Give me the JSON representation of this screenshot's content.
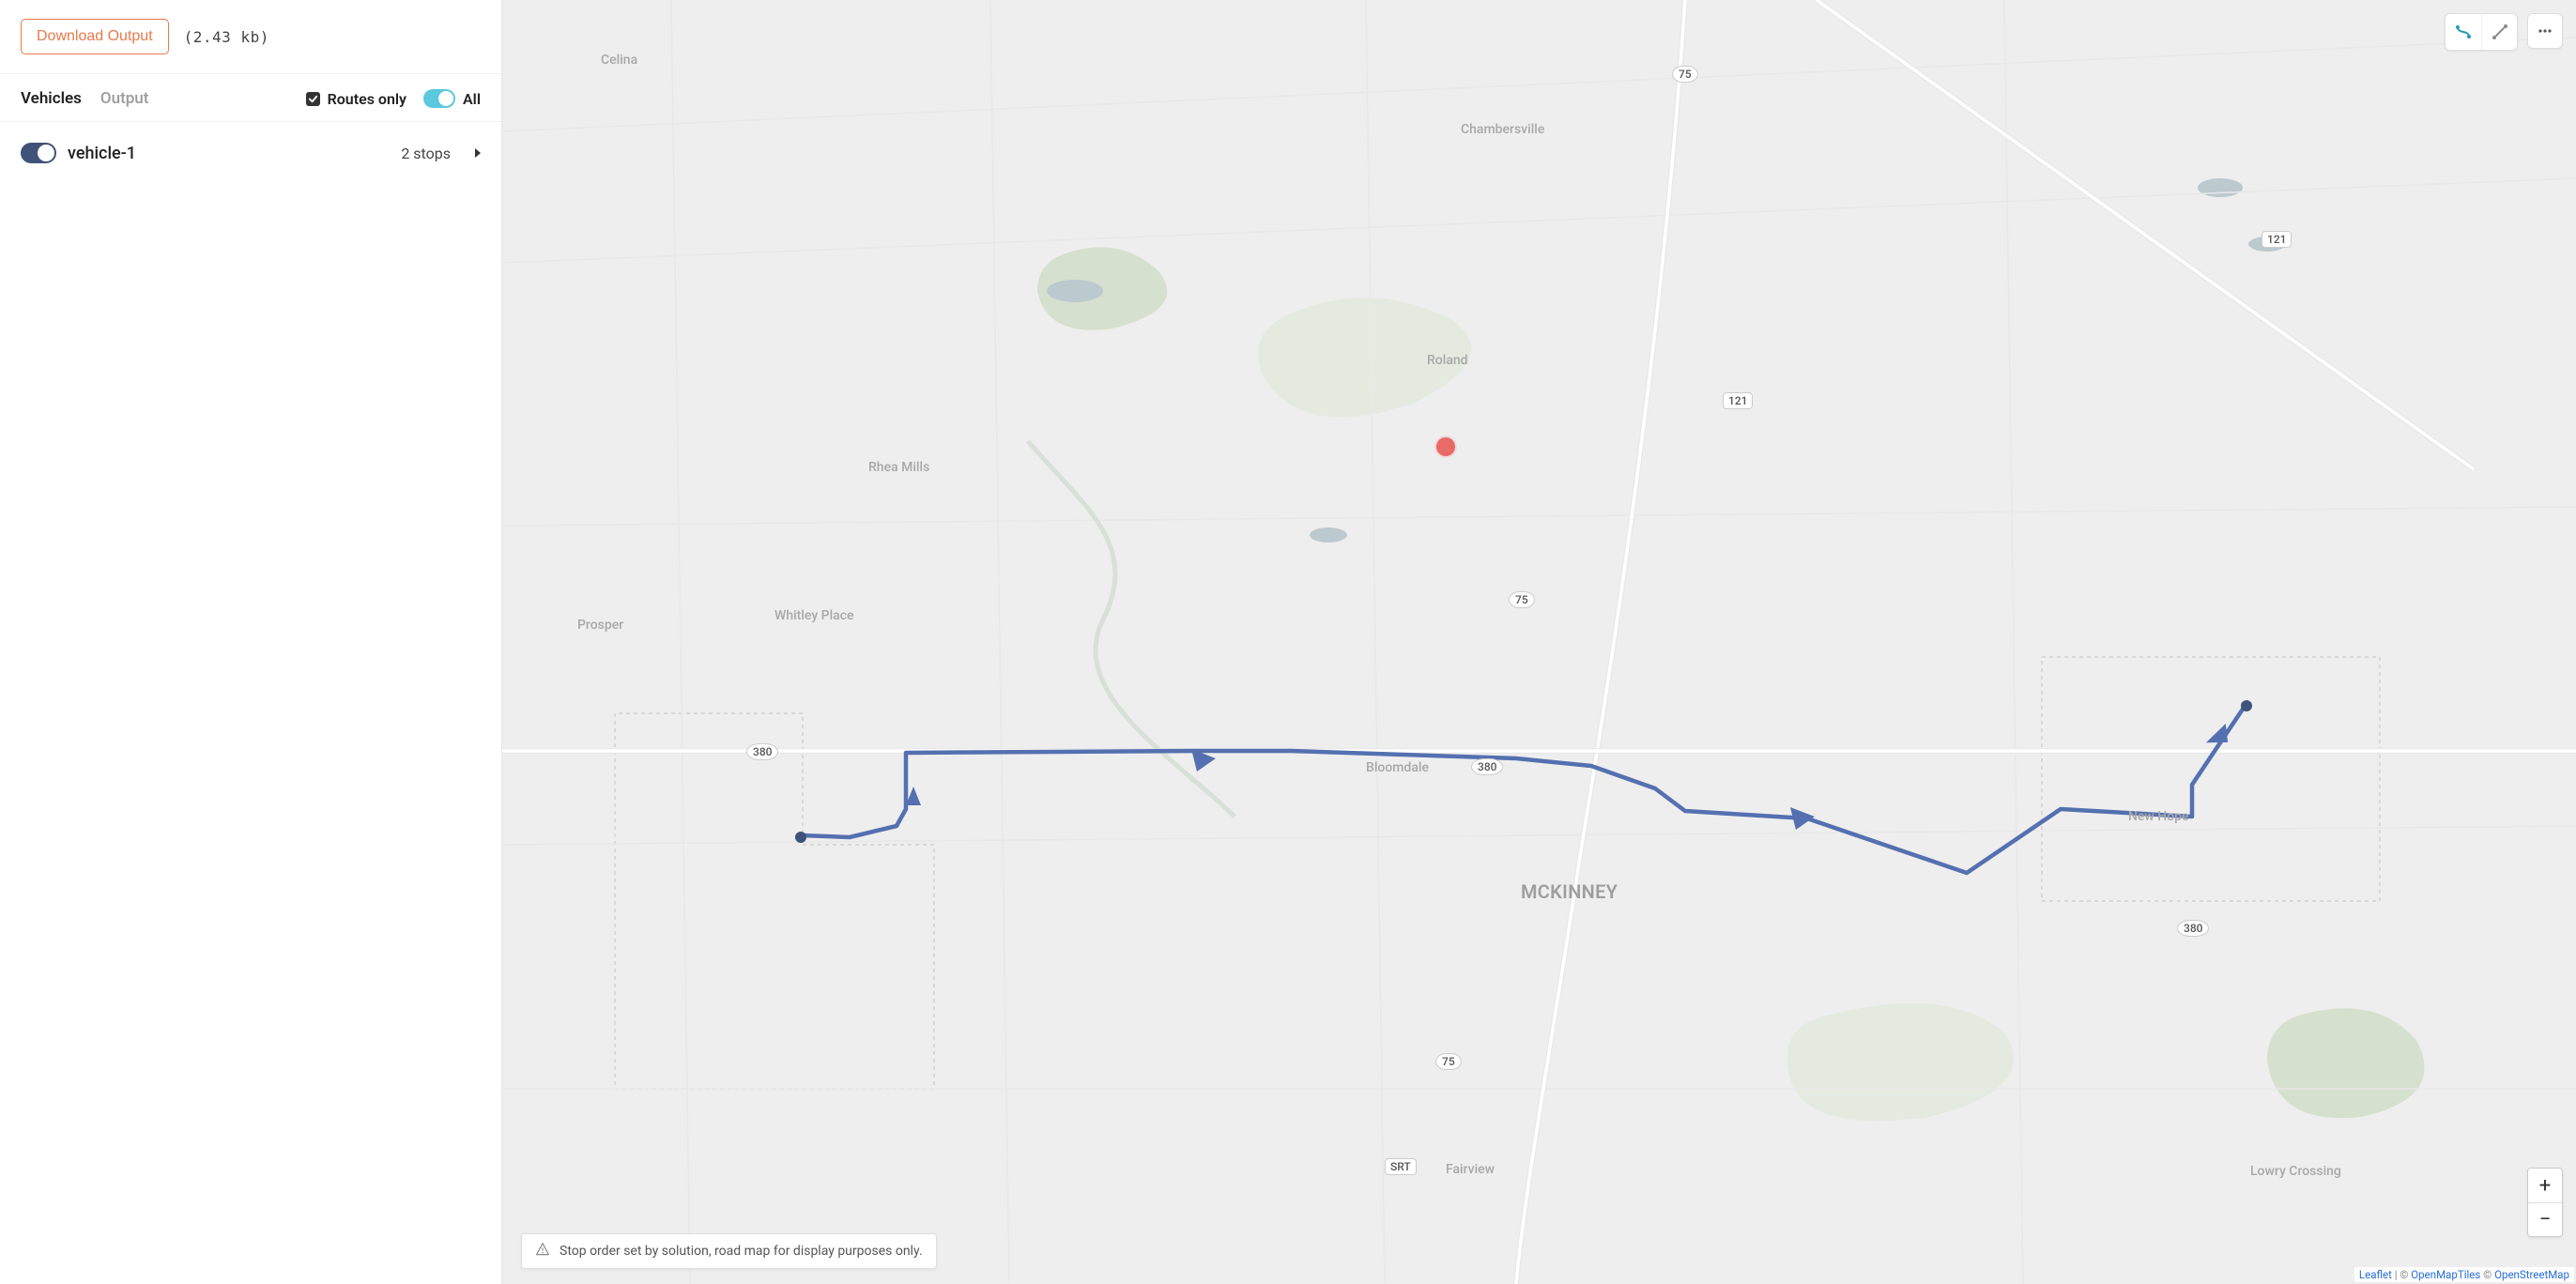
{
  "topbar": {
    "download_label": "Download Output",
    "filesize_display": "(2.43 kb)"
  },
  "tabs": {
    "vehicles_label": "Vehicles",
    "output_label": "Output"
  },
  "filters": {
    "routes_only_label": "Routes only",
    "all_label": "All",
    "routes_only_checked": true,
    "all_toggle_on": true
  },
  "vehicles": [
    {
      "name": "vehicle-1",
      "stops_text": "2 stops",
      "enabled": true
    }
  ],
  "map": {
    "banner_text": "Stop order set by solution, road map for display purposes only.",
    "labels": {
      "celina": "Celina",
      "chambersville": "Chambersville",
      "roland": "Roland",
      "rhea_mills": "Rhea Mills",
      "whitley_place": "Whitley Place",
      "prosper": "Prosper",
      "bloomdale": "Bloomdale",
      "new_hope": "New Hope",
      "mckinney": "MCKINNEY",
      "fairview": "Fairview",
      "lowry_crossing": "Lowry Crossing"
    },
    "shields": {
      "us75_top": "75",
      "s121": "121",
      "s121b": "121",
      "us75_mid": "75",
      "us380_left": "380",
      "us380_mid": "380",
      "us380_right": "380",
      "us75_low": "75",
      "srt": "SRT"
    },
    "attribution": {
      "leaflet": "Leaflet",
      "sep1": " | © ",
      "omt": "OpenMapTiles",
      "sep2": " © ",
      "osm": "OpenStreetMap"
    },
    "zoom": {
      "in": "+",
      "out": "−"
    }
  }
}
